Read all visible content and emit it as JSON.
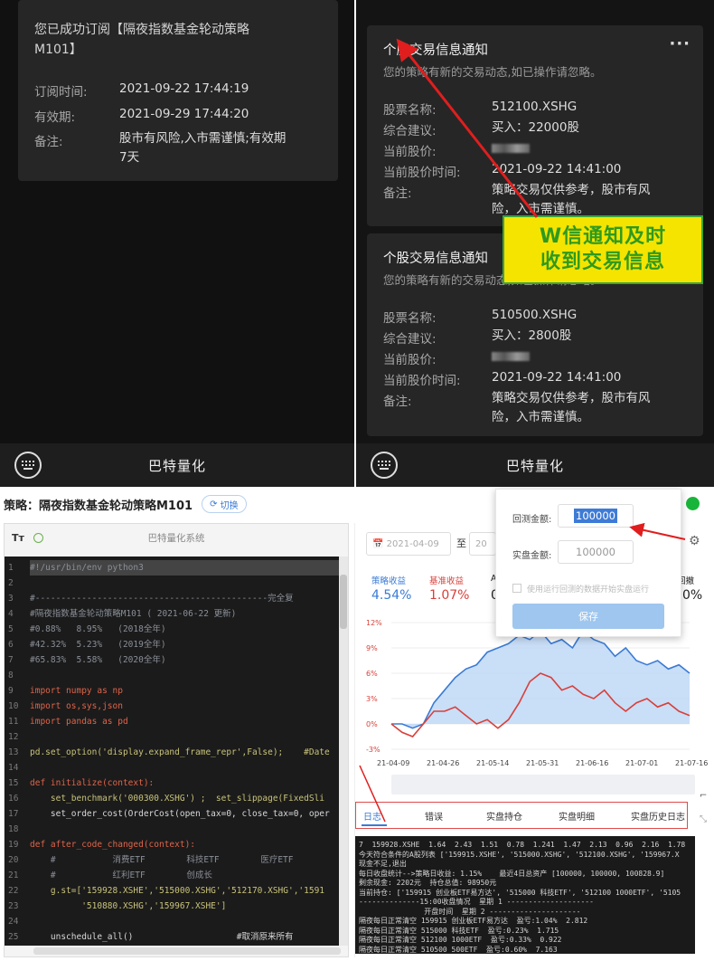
{
  "top_left": {
    "subscription_msg_line1": "您已成功订阅【隔夜指数基金轮动策略",
    "subscription_msg_line2": "M101】",
    "fields": [
      {
        "label": "订阅时间:",
        "value": "2021-09-22 17:44:19"
      },
      {
        "label": "有效期:",
        "value": "2021-09-29 17:44:20"
      },
      {
        "label": "备注:",
        "value": "股市有风险,入市需谨慎;有效期"
      }
    ],
    "note_line2": "7天",
    "bottom_label": "巴特量化"
  },
  "top_right": {
    "card1": {
      "title": "个股交易信息通知",
      "desc": "您的策略有新的交易动态,如已操作请忽略。",
      "rows": [
        {
          "label": "股票名称:",
          "value": "512100.XSHG"
        },
        {
          "label": "综合建议:",
          "value": "买入：22000股"
        },
        {
          "label": "当前股价:",
          "value": ""
        },
        {
          "label": "当前股价时间:",
          "value": "2021-09-22 14:41:00"
        },
        {
          "label": "备注:",
          "value": "策略交易仅供参考，股市有风"
        }
      ],
      "note_line2": "险，入市需谨慎。"
    },
    "card2": {
      "title": "个股交易信息通知",
      "desc": "您的策略有新的交易动态,如已操作请忽略。",
      "rows": [
        {
          "label": "股票名称:",
          "value": "510500.XSHG"
        },
        {
          "label": "综合建议:",
          "value": "买入：2800股"
        },
        {
          "label": "当前股价:",
          "value": ""
        },
        {
          "label": "当前股价时间:",
          "value": "2021-09-22 14:41:00"
        },
        {
          "label": "备注:",
          "value": "策略交易仅供参考，股市有风"
        }
      ],
      "note_line2": "险，入市需谨慎。"
    },
    "banner_line1": "W信通知及时",
    "banner_line2": "收到交易信息",
    "bottom_label": "巴特量化"
  },
  "ide": {
    "strategy_title": "策略：隔夜指数基金轮动策略M101",
    "switch_label": "切换",
    "toolbar_tt": "Tт",
    "system_name": "巴特量化系统",
    "code_lines": [
      {
        "n": "1",
        "text": "#!/usr/bin/env python3"
      },
      {
        "n": "2",
        "text": ""
      },
      {
        "n": "3",
        "text": "#---------------------------------------------完全复"
      },
      {
        "n": "4",
        "text": "#隔夜指数基金轮动策略M101 ( 2021-06-22 更新)"
      },
      {
        "n": "5",
        "text": "#0.88%   8.95%   (2018全年)"
      },
      {
        "n": "6",
        "text": "#42.32%  5.23%   (2019全年)"
      },
      {
        "n": "7",
        "text": "#65.83%  5.58%   (2020全年)"
      },
      {
        "n": "8",
        "text": ""
      },
      {
        "n": "9",
        "text": "import numpy as np"
      },
      {
        "n": "10",
        "text": "import os,sys,json"
      },
      {
        "n": "11",
        "text": "import pandas as pd"
      },
      {
        "n": "12",
        "text": ""
      },
      {
        "n": "13",
        "text": "pd.set_option('display.expand_frame_repr',False);    #Date"
      },
      {
        "n": "14",
        "text": ""
      },
      {
        "n": "15",
        "text": "def initialize(context):"
      },
      {
        "n": "16",
        "text": "    set_benchmark('000300.XSHG') ;  set_slippage(FixedSli"
      },
      {
        "n": "17",
        "text": "    set_order_cost(OrderCost(open_tax=0, close_tax=0, oper"
      },
      {
        "n": "18",
        "text": ""
      },
      {
        "n": "19",
        "text": "def after_code_changed(context):"
      },
      {
        "n": "20",
        "text": "    #           消费ETF        科技ETF        医疗ETF        "
      },
      {
        "n": "21",
        "text": "    #           红利ETF        创成长"
      },
      {
        "n": "22",
        "text": "    g.st=['159928.XSHE','515000.XSHG','512170.XSHG','1591"
      },
      {
        "n": "23",
        "text": "          '510880.XSHG','159967.XSHE']"
      },
      {
        "n": "24",
        "text": ""
      },
      {
        "n": "25",
        "text": "    unschedule_all()                    #取消原来所有"
      }
    ],
    "date_from": "2021-04-09",
    "date_to_label": "至",
    "date_to": "20",
    "metrics": [
      {
        "label": "策略收益",
        "value": "4.54%",
        "color": "#3a7bd5"
      },
      {
        "label": "基准收益",
        "value": "1.07%",
        "color": "#d8403a"
      },
      {
        "label": "A",
        "value": "0",
        "color": "#222"
      },
      {
        "label": "回撤",
        "value": "0%",
        "color": "#222"
      }
    ],
    "chart_yticks": [
      "12%",
      "9%",
      "6%",
      "3%",
      "0%",
      "-3%"
    ],
    "chart_xticks": [
      "21-04-09",
      "21-04-26",
      "21-05-14",
      "21-05-31",
      "21-06-16",
      "21-07-01",
      "21-07-16"
    ],
    "tabs": [
      "日志",
      "错误",
      "实盘持仓",
      "实盘明细",
      "实盘历史日志"
    ],
    "log_lines": [
      "7  159928.XSHE  1.64  2.43  1.51  0.78  1.241  1.47  2.13  0.96  2.16  1.78",
      "今天符合条件的A股列表 ['159915.XSHE', '515000.XSHG', '512100.XSHG', '159967.X",
      "现金不足,退出",
      "每日收盘统计-->策略日收益: 1.15%    最近4日总资产 [100000, 100000, 100828.9]",
      "剩余现金: 2202元  持仓总值: 98950元",
      "当前持仓: ['159915 创业板ETF易方达', '515000 科技ETF', '512100 1000ETF', '5105",
      "--------------15:00收盘情况  星期 1 --------------------",
      "               开盘时间  星期 2 ---------------------",
      "隔夜每日正常清空 159915 创业板ETF易方达  盈亏:1.04%  2.812",
      "隔夜每日正常清空 515000 科技ETF  盈亏:0.23%  1.715",
      "隔夜每日正常清空 512100 1000ETF  盈亏:0.33%  0.922",
      "隔夜每日正常清空 510500 500ETF  盈亏:0.60%  7.163"
    ],
    "popup": {
      "backtest_label": "回测金额:",
      "backtest_value": "100000",
      "live_label": "实盘金额:",
      "live_value": "100000",
      "checkbox_label": "使用运行回测的数据开始实盘运行",
      "save_label": "保存"
    }
  },
  "chart_data": {
    "type": "area",
    "x": [
      "21-04-09",
      "21-04-26",
      "21-05-14",
      "21-05-31",
      "21-06-16",
      "21-07-01",
      "21-07-16"
    ],
    "ylim": [
      -3,
      12
    ],
    "series": [
      {
        "name": "策略收益",
        "color": "#3a7bd5",
        "values": [
          0,
          0,
          -0.5,
          0,
          2.5,
          4,
          5.5,
          6.5,
          7,
          8.5,
          9,
          9.5,
          10.5,
          10,
          11,
          9.5,
          10,
          9,
          11,
          10,
          9.5,
          8,
          9,
          7.5,
          7,
          7.5,
          6.5,
          7,
          6
        ]
      },
      {
        "name": "基准收益",
        "color": "#d8403a",
        "values": [
          0,
          -1,
          -1.5,
          0,
          1.5,
          1.5,
          2,
          1,
          0,
          0.5,
          -0.5,
          0.5,
          2.5,
          5,
          6,
          5.5,
          4,
          4.5,
          3.5,
          3,
          4,
          2.5,
          1.5,
          2.5,
          3,
          2,
          2.5,
          1.5,
          1
        ]
      }
    ]
  }
}
